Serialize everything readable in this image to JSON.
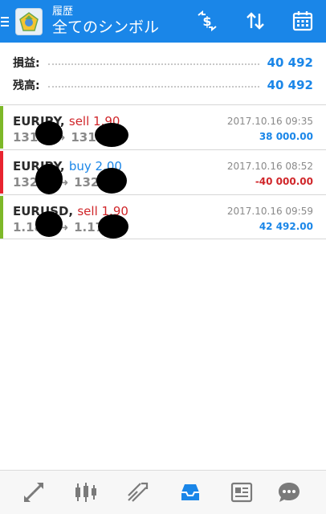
{
  "header": {
    "subtitle": "履歴",
    "title": "全てのシンボル",
    "bg_color": "#1a86e8"
  },
  "summary": {
    "profit_label": "損益:",
    "profit_value": "40 492",
    "balance_label": "残高:",
    "balance_value": "40 492"
  },
  "trades": [
    {
      "symbol": "EURJPY,",
      "action": "sell 1.90",
      "action_type": "sell",
      "price_open": "131",
      "price_close": "131",
      "time": "2017.10.16 09:35",
      "profit": "38 000.00",
      "profit_positive": true
    },
    {
      "symbol": "EURJPY,",
      "action": "buy 2.00",
      "action_type": "buy",
      "price_open": "132.",
      "price_close": "132",
      "time": "2017.10.16 08:52",
      "profit": "-40 000.00",
      "profit_positive": false
    },
    {
      "symbol": "EURUSD,",
      "action": "sell 1.90",
      "action_type": "sell",
      "price_open": "1.18",
      "price_close": "1.17",
      "time": "2017.10.16 09:59",
      "profit": "42 492.00",
      "profit_positive": true
    }
  ],
  "colors": {
    "blue": "#1a86e8",
    "sell": "#d0262a",
    "buy": "#1a86e8",
    "loss": "#d0262a",
    "bar_green": "#7db828",
    "bar_red": "#e8232f"
  },
  "icons": {
    "header": [
      "exchange-dollar-icon",
      "sort-icon",
      "calendar-icon"
    ],
    "nav": [
      "quotes-icon",
      "chart-candles-icon",
      "trade-icon",
      "history-icon",
      "news-icon",
      "chat-icon"
    ]
  }
}
